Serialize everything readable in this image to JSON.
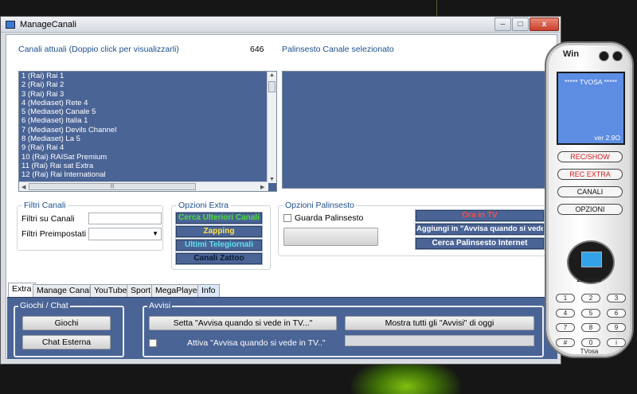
{
  "window": {
    "title": "ManageCanali",
    "minimize": "–",
    "maximize": "□",
    "close": "x"
  },
  "channels": {
    "header": "Canali attuali (Doppio click per visualizzarli)",
    "count": "646",
    "items": [
      "1 (Rai) Rai 1",
      "2 (Rai) Rai 2",
      "3 (Rai) Rai 3",
      "4 (Mediaset) Rete 4",
      "5 (Mediaset) Canale 5",
      "6 (Mediaset) Italia 1",
      "7 (Mediaset) Devils Channel",
      "8 (Mediaset) La 5",
      "9 (Rai) Rai 4",
      "10 (Rai) RAISat Premium",
      "11 (Rai) Rai sat Extra",
      "12 (Rai) Rai International"
    ]
  },
  "schedule": {
    "header": "Palinsesto Canale selezionato"
  },
  "filters": {
    "title": "Filtri Canali",
    "channel_filter_label": "Filtri su Canali",
    "channel_filter_value": "",
    "preset_filter_label": "Filtri Preimpostati",
    "preset_filter_value": ""
  },
  "extra_options": {
    "title": "Opzioni Extra",
    "buttons": [
      "Cerca Ulteriori Canali",
      "Zapping",
      "Ultimi Telegiornali",
      "Canali Zattoo"
    ]
  },
  "schedule_options": {
    "title": "Opzioni Palinsesto",
    "watch_schedule_label": "Guarda Palinsesto",
    "watch_schedule_checked": false,
    "buttons": [
      "Ora in TV",
      "Aggiungi in \"Avvisa quando si vede\"",
      "Cerca Palinsesto Internet"
    ]
  },
  "tabs": [
    "Extra",
    "Manage Canali",
    "YouTube",
    "Sport",
    "MegaPlayer",
    "Info"
  ],
  "active_tab": "Extra",
  "games": {
    "title": "Giochi / Chat",
    "games_button": "Giochi",
    "chat_button": "Chat Esterna"
  },
  "alerts": {
    "title": "Avvisi",
    "set_button": "Setta \"Avvisa quando si vede in TV...\"",
    "show_all_button": "Mostra tutti gli \"Avvisi\" di oggi",
    "enable_label": "Attiva \"Avvisa quando si vede in TV..\"",
    "enable_checked": false
  },
  "remote": {
    "logo": "Win",
    "screen_title": "***** TVOSA *****",
    "version": "ver 2.9O",
    "buttons": [
      "REC/SHOW",
      "REC EXTRA",
      "CANALI",
      "OPZIONI"
    ],
    "zapping_label": "ZAPPING",
    "keys": [
      "1",
      "2",
      "3",
      "4",
      "5",
      "6",
      "7",
      "8",
      "9",
      "#",
      "0",
      "i"
    ],
    "brand": "TVosa"
  },
  "colors": {
    "panel_blue": "#4a6496",
    "accent_red": "#d62020"
  }
}
